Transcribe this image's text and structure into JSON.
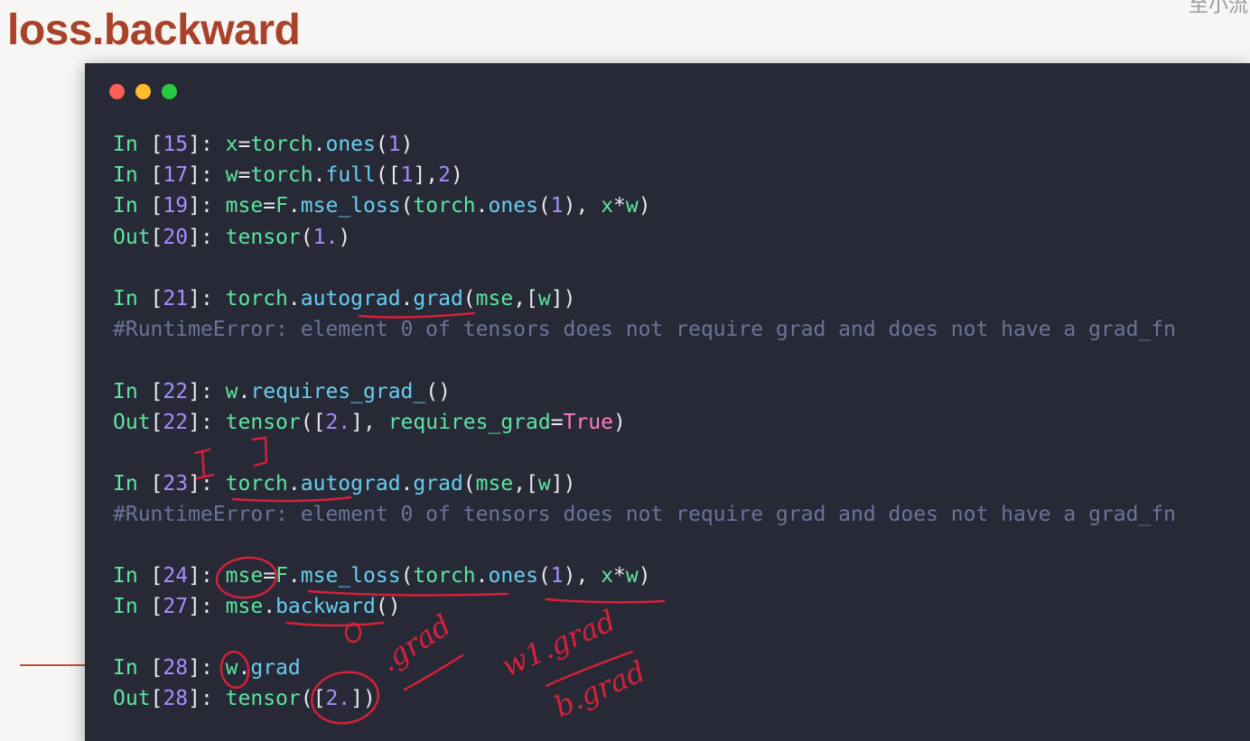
{
  "slide": {
    "title": "loss.backward",
    "corner_text": "至小流"
  },
  "window": {
    "traffic_lights": [
      {
        "name": "close",
        "color": "#ff5f56"
      },
      {
        "name": "minimize",
        "color": "#ffbd2e"
      },
      {
        "name": "maximize",
        "color": "#27c93f"
      }
    ]
  },
  "colors": {
    "prompt_in": "#5ee4a0",
    "prompt_out": "#5ee4a0",
    "prompt_number": "#a98bff",
    "identifier": "#5ee4a0",
    "function": "#67cdf0",
    "number": "#a98bff",
    "keyword": "#ff79c6",
    "plain": "#e7e9ee",
    "comment": "#6b7399",
    "annotation": "#d8203a"
  },
  "code_lines": [
    {
      "tokens": [
        [
          "In ",
          "prompt_in"
        ],
        [
          "[",
          "plain"
        ],
        [
          "15",
          "prompt_number"
        ],
        [
          "]: ",
          "plain"
        ],
        [
          "x",
          "identifier"
        ],
        [
          "=",
          "plain"
        ],
        [
          "torch",
          "identifier"
        ],
        [
          ".",
          "plain"
        ],
        [
          "ones",
          "function"
        ],
        [
          "(",
          "plain"
        ],
        [
          "1",
          "number"
        ],
        [
          ")",
          "plain"
        ]
      ]
    },
    {
      "tokens": [
        [
          "In ",
          "prompt_in"
        ],
        [
          "[",
          "plain"
        ],
        [
          "17",
          "prompt_number"
        ],
        [
          "]: ",
          "plain"
        ],
        [
          "w",
          "identifier"
        ],
        [
          "=",
          "plain"
        ],
        [
          "torch",
          "identifier"
        ],
        [
          ".",
          "plain"
        ],
        [
          "full",
          "function"
        ],
        [
          "([",
          "plain"
        ],
        [
          "1",
          "number"
        ],
        [
          "],",
          "plain"
        ],
        [
          "2",
          "number"
        ],
        [
          ")",
          "plain"
        ]
      ]
    },
    {
      "tokens": [
        [
          "In ",
          "prompt_in"
        ],
        [
          "[",
          "plain"
        ],
        [
          "19",
          "prompt_number"
        ],
        [
          "]: ",
          "plain"
        ],
        [
          "mse",
          "identifier"
        ],
        [
          "=",
          "plain"
        ],
        [
          "F",
          "identifier"
        ],
        [
          ".",
          "plain"
        ],
        [
          "mse_loss",
          "function"
        ],
        [
          "(",
          "plain"
        ],
        [
          "torch",
          "identifier"
        ],
        [
          ".",
          "plain"
        ],
        [
          "ones",
          "function"
        ],
        [
          "(",
          "plain"
        ],
        [
          "1",
          "number"
        ],
        [
          "), ",
          "plain"
        ],
        [
          "x",
          "identifier"
        ],
        [
          "*",
          "plain"
        ],
        [
          "w",
          "identifier"
        ],
        [
          ")",
          "plain"
        ]
      ]
    },
    {
      "tokens": [
        [
          "Out",
          "prompt_out"
        ],
        [
          "[",
          "plain"
        ],
        [
          "20",
          "prompt_number"
        ],
        [
          "]: ",
          "plain"
        ],
        [
          "tensor",
          "identifier"
        ],
        [
          "(",
          "plain"
        ],
        [
          "1.",
          "number"
        ],
        [
          ")",
          "plain"
        ]
      ]
    },
    {
      "tokens": [
        [
          "In ",
          "prompt_in"
        ],
        [
          "[",
          "plain"
        ],
        [
          "21",
          "prompt_number"
        ],
        [
          "]: ",
          "plain"
        ],
        [
          "torch",
          "identifier"
        ],
        [
          ".",
          "plain"
        ],
        [
          "autograd",
          "function"
        ],
        [
          ".",
          "plain"
        ],
        [
          "grad",
          "function"
        ],
        [
          "(",
          "plain"
        ],
        [
          "mse",
          "identifier"
        ],
        [
          ",[",
          "plain"
        ],
        [
          "w",
          "identifier"
        ],
        [
          "])",
          "plain"
        ]
      ]
    },
    {
      "tokens": [
        [
          "#RuntimeError: element 0 of tensors does not require grad and does not have a grad_fn",
          "comment"
        ]
      ]
    },
    {
      "tokens": [
        [
          "In ",
          "prompt_in"
        ],
        [
          "[",
          "plain"
        ],
        [
          "22",
          "prompt_number"
        ],
        [
          "]: ",
          "plain"
        ],
        [
          "w",
          "identifier"
        ],
        [
          ".",
          "plain"
        ],
        [
          "requires_grad_",
          "function"
        ],
        [
          "()",
          "plain"
        ]
      ]
    },
    {
      "tokens": [
        [
          "Out",
          "prompt_out"
        ],
        [
          "[",
          "plain"
        ],
        [
          "22",
          "prompt_number"
        ],
        [
          "]: ",
          "plain"
        ],
        [
          "tensor",
          "identifier"
        ],
        [
          "([",
          "plain"
        ],
        [
          "2.",
          "number"
        ],
        [
          "], ",
          "plain"
        ],
        [
          "requires_grad",
          "identifier"
        ],
        [
          "=",
          "plain"
        ],
        [
          "True",
          "keyword"
        ],
        [
          ")",
          "plain"
        ]
      ]
    },
    {
      "tokens": [
        [
          "In ",
          "prompt_in"
        ],
        [
          "[",
          "plain"
        ],
        [
          "23",
          "prompt_number"
        ],
        [
          "]: ",
          "plain"
        ],
        [
          "torch",
          "identifier"
        ],
        [
          ".",
          "plain"
        ],
        [
          "autograd",
          "function"
        ],
        [
          ".",
          "plain"
        ],
        [
          "grad",
          "function"
        ],
        [
          "(",
          "plain"
        ],
        [
          "mse",
          "identifier"
        ],
        [
          ",[",
          "plain"
        ],
        [
          "w",
          "identifier"
        ],
        [
          "])",
          "plain"
        ]
      ]
    },
    {
      "tokens": [
        [
          "#RuntimeError: element 0 of tensors does not require grad and does not have a grad_fn",
          "comment"
        ]
      ]
    },
    {
      "tokens": [
        [
          "In ",
          "prompt_in"
        ],
        [
          "[",
          "plain"
        ],
        [
          "24",
          "prompt_number"
        ],
        [
          "]: ",
          "plain"
        ],
        [
          "mse",
          "identifier"
        ],
        [
          "=",
          "plain"
        ],
        [
          "F",
          "identifier"
        ],
        [
          ".",
          "plain"
        ],
        [
          "mse_loss",
          "function"
        ],
        [
          "(",
          "plain"
        ],
        [
          "torch",
          "identifier"
        ],
        [
          ".",
          "plain"
        ],
        [
          "ones",
          "function"
        ],
        [
          "(",
          "plain"
        ],
        [
          "1",
          "number"
        ],
        [
          "), ",
          "plain"
        ],
        [
          "x",
          "identifier"
        ],
        [
          "*",
          "plain"
        ],
        [
          "w",
          "identifier"
        ],
        [
          ")",
          "plain"
        ]
      ]
    },
    {
      "tokens": [
        [
          "In ",
          "prompt_in"
        ],
        [
          "[",
          "plain"
        ],
        [
          "27",
          "prompt_number"
        ],
        [
          "]: ",
          "plain"
        ],
        [
          "mse",
          "identifier"
        ],
        [
          ".",
          "plain"
        ],
        [
          "backward",
          "function"
        ],
        [
          "()",
          "plain"
        ]
      ]
    },
    {
      "tokens": [
        [
          "In ",
          "prompt_in"
        ],
        [
          "[",
          "plain"
        ],
        [
          "28",
          "prompt_number"
        ],
        [
          "]: ",
          "plain"
        ],
        [
          "w",
          "identifier"
        ],
        [
          ".",
          "plain"
        ],
        [
          "grad",
          "function"
        ]
      ]
    },
    {
      "tokens": [
        [
          "Out",
          "prompt_out"
        ],
        [
          "[",
          "plain"
        ],
        [
          "28",
          "prompt_number"
        ],
        [
          "]: ",
          "plain"
        ],
        [
          "tensor",
          "identifier"
        ],
        [
          "([",
          "plain"
        ],
        [
          "2.",
          "number"
        ],
        [
          "])",
          "plain"
        ]
      ]
    }
  ],
  "annotations": {
    "grad_note": ".grad",
    "w1_grad": "w1.grad",
    "b_grad": "b.grad",
    "zero_mark": "0"
  }
}
